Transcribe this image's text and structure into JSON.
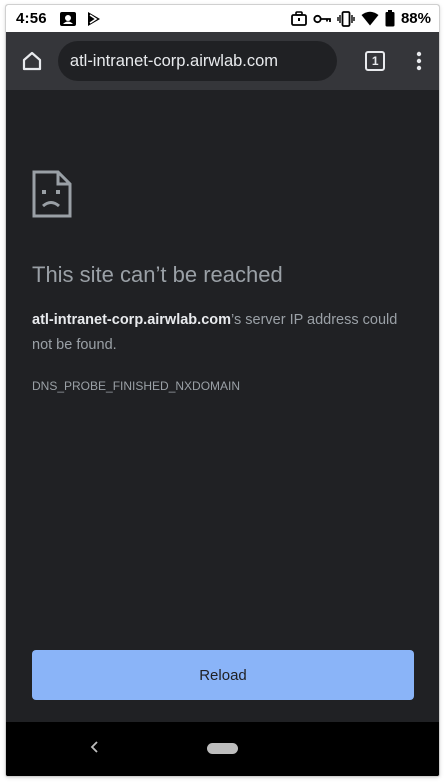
{
  "status_bar": {
    "time": "4:56",
    "battery_percent": "88%",
    "left_icons": [
      "screen-record-icon",
      "play-store-icon"
    ],
    "right_icons": [
      "briefcase-icon",
      "vpn-key-icon",
      "vibrate-icon",
      "wifi-icon",
      "battery-icon"
    ]
  },
  "toolbar": {
    "url": "atl-intranet-corp.airwlab.com",
    "tab_count": "1",
    "icons": [
      "home-icon",
      "tab-switcher-icon",
      "more-vert-icon"
    ]
  },
  "error": {
    "title": "This site can’t be reached",
    "host": "atl-intranet-corp.airwlab.com",
    "message_rest": "’s server IP address could not be found.",
    "code": "DNS_PROBE_FINISHED_NXDOMAIN",
    "icon": "sad-page-icon"
  },
  "actions": {
    "reload_label": "Reload"
  },
  "nav_bar": {
    "icons": [
      "back-icon",
      "home-pill-icon"
    ]
  },
  "colors": {
    "page_background": "#202124",
    "toolbar_background": "#35363a",
    "button_accent": "#8ab4f8",
    "text_muted": "#9aa0a6",
    "text_strong": "#e8eaed"
  }
}
